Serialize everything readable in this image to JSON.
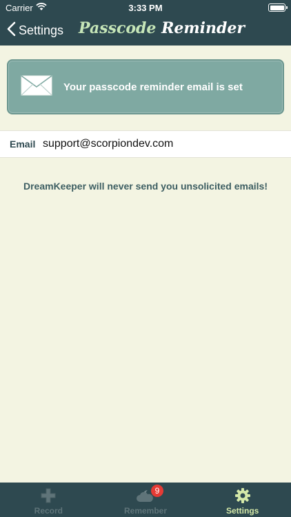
{
  "status_bar": {
    "carrier": "Carrier",
    "time": "3:33 PM"
  },
  "nav": {
    "back_label": "Settings",
    "title_part1": "Passcode",
    "title_part2": "Reminder"
  },
  "banner": {
    "message": "Your passcode reminder email is set"
  },
  "email": {
    "label": "Email",
    "value": "support@scorpiondev.com"
  },
  "notice": "DreamKeeper will never send you unsolicited emails!",
  "tabs": [
    {
      "label": "Record",
      "icon": "plus-cross-icon"
    },
    {
      "label": "Remember",
      "icon": "cloud-moon-icon",
      "badge": "9"
    },
    {
      "label": "Settings",
      "icon": "gear-icon",
      "active": true
    }
  ],
  "colors": {
    "header": "#2e4950",
    "background": "#f3f4e2",
    "banner": "#7fa9a2",
    "active_tab": "#d4e8a8",
    "badge": "#e53b35"
  }
}
